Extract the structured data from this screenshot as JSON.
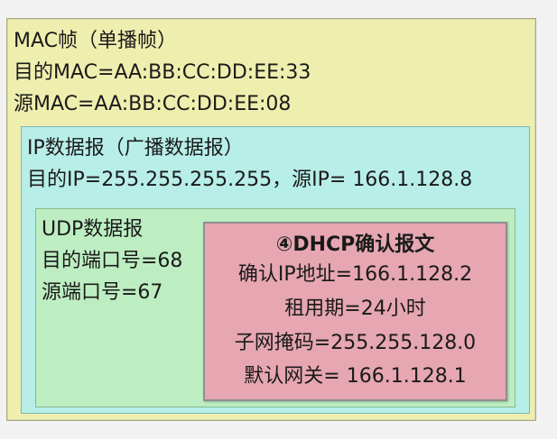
{
  "mac_frame": {
    "title": "MAC帧（单播帧）",
    "dest": "目的MAC=AA:BB:CC:DD:EE:33",
    "src": "源MAC=AA:BB:CC:DD:EE:08",
    "bg_color": "#eeefae"
  },
  "ip_packet": {
    "title": "IP数据报（广播数据报）",
    "addresses": "目的IP=255.255.255.255，源IP= 166.1.128.8",
    "bg_color": "#b8eee8"
  },
  "udp_datagram": {
    "title": "UDP数据报",
    "dest_port": "目的端口号=68",
    "src_port": "源端口号=67",
    "bg_color": "#bdeec2"
  },
  "dhcp_message": {
    "title": "④DHCP确认报文",
    "ip": "确认IP地址=166.1.128.2",
    "lease": "租用期=24小时",
    "mask": "子网掩码=255.255.128.0",
    "gateway": "默认网关= 166.1.128.1",
    "bg_color": "#e6a6b2"
  }
}
